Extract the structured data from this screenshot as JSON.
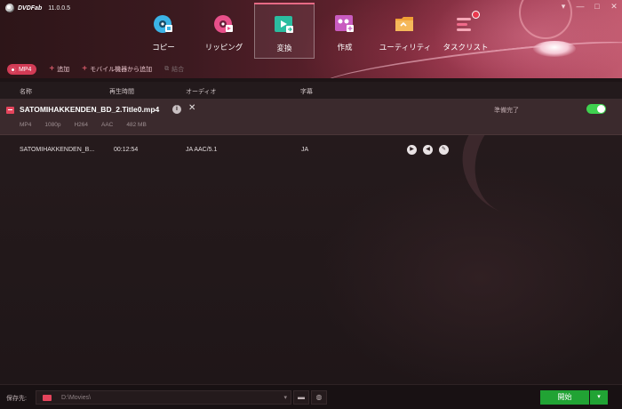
{
  "app": {
    "logo": "DVDFab",
    "version": "11.0.0.5"
  },
  "nav": {
    "items": [
      {
        "label": "コピー",
        "icon": "copy-disc-icon",
        "color": "#3bb3e6"
      },
      {
        "label": "リッピング",
        "icon": "ripper-disc-icon",
        "color": "#e8508a"
      },
      {
        "label": "変換",
        "icon": "converter-icon",
        "color": "#2bbda0",
        "active": true
      },
      {
        "label": "作成",
        "icon": "creator-icon",
        "color": "#c95cc0"
      },
      {
        "label": "ユーティリティ",
        "icon": "utility-folder-icon",
        "color": "#f0a035"
      },
      {
        "label": "タスクリスト",
        "icon": "task-list-icon",
        "color": "#f06a8a"
      }
    ]
  },
  "toolbar": {
    "profile": "MP4",
    "add": "追加",
    "add_mobile": "モバイル機器から追加",
    "merge": "結合"
  },
  "columns": {
    "name": "名称",
    "duration": "再生時間",
    "audio": "オーディオ",
    "subtitle": "字幕"
  },
  "file": {
    "title": "SATOMIHAKKENDEN_BD_2.Title0.mp4",
    "meta": [
      "MP4",
      "1080p",
      "H264",
      "AAC",
      "482 MB"
    ],
    "status": "準備完了",
    "toggle_on": true
  },
  "track": {
    "name": "SATOMIHAKKENDEN_B...",
    "duration": "00:12:54",
    "audio": "JA AAC/5.1",
    "subtitle": "JA"
  },
  "footer": {
    "save_label": "保存先:",
    "path": "D:\\Movies\\",
    "start": "開始"
  }
}
